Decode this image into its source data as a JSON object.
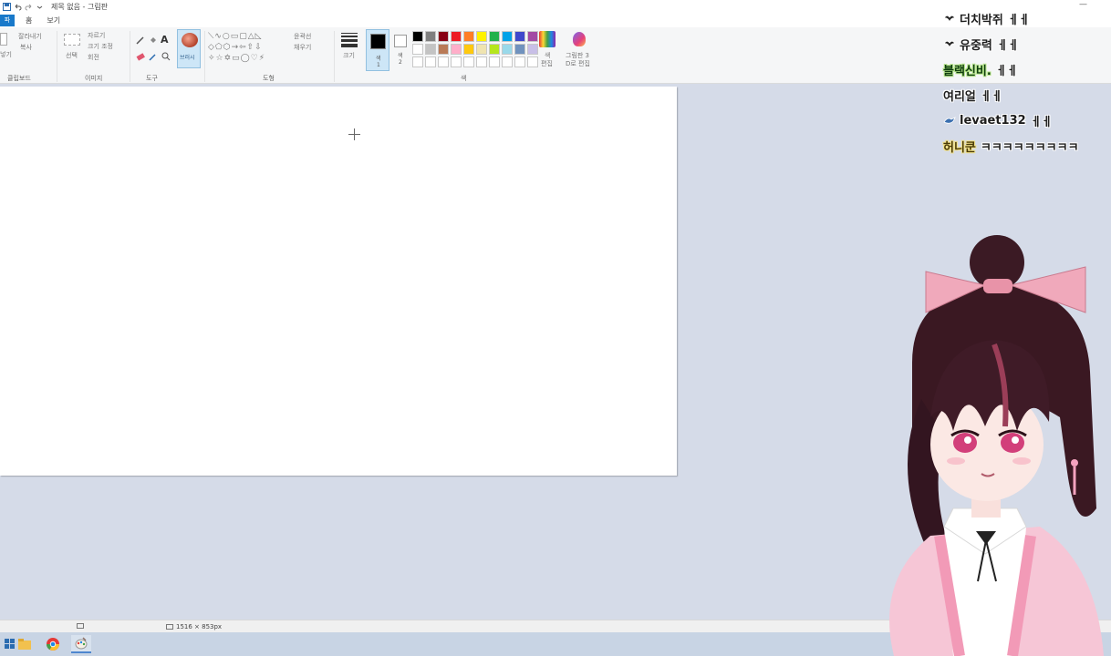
{
  "window": {
    "title": "제목 없음 - 그림판",
    "minimize": "—"
  },
  "tabs": {
    "file": "파",
    "home": "홈",
    "view": "보기"
  },
  "ribbon": {
    "clipboard": {
      "paste": "붙여",
      "paste2": "넣기",
      "cut": "잘라내기",
      "copy": "복사",
      "label": "클립보드"
    },
    "image": {
      "select": "선택",
      "crop": "자르기",
      "resize": "크기 조정",
      "rotate": "회전",
      "label": "이미지"
    },
    "tools": {
      "label": "도구"
    },
    "brushes": {
      "label": "브러시"
    },
    "shapes": {
      "outline": "윤곽선",
      "fill": "채우기",
      "label": "도형"
    },
    "size": {
      "label": "크기"
    },
    "colors": {
      "color1_label": "색",
      "color1_num": "1",
      "color2_label": "색",
      "color2_num": "2",
      "edit": "색",
      "edit2": "편집",
      "paint3d": "그림판 3",
      "paint3d2": "D로 편집",
      "label": "색",
      "palette": [
        "#000000",
        "#7f7f7f",
        "#880015",
        "#ed1c24",
        "#ff7f27",
        "#fff200",
        "#22b14c",
        "#00a2e8",
        "#3f48cc",
        "#a349a4",
        "#ffffff",
        "#c3c3c3",
        "#b97a57",
        "#ffaec9",
        "#ffc90e",
        "#efe4b0",
        "#b5e61d",
        "#99d9ea",
        "#7092be",
        "#c8bfe7",
        "#ffffff",
        "#ffffff",
        "#ffffff",
        "#ffffff",
        "#ffffff",
        "#ffffff",
        "#ffffff",
        "#ffffff",
        "#ffffff",
        "#ffffff"
      ]
    }
  },
  "status": {
    "size": "1516 × 853px"
  },
  "chat": [
    {
      "nick": "더치박쥐",
      "msg": "ㅔㅔ",
      "style": "nick",
      "badge": "bat"
    },
    {
      "nick": "유중력",
      "msg": "ㅔㅔ",
      "style": "nick",
      "badge": "bat"
    },
    {
      "nick": "블랙신비.",
      "msg": "ㅔㅔ",
      "style": "nick-green",
      "badge": ""
    },
    {
      "nick": "여리얼",
      "msg": "ㅔㅔ",
      "style": "nick",
      "badge": ""
    },
    {
      "nick": "levaet132",
      "msg": "ㅔㅔ",
      "style": "nick",
      "badge": "bird"
    },
    {
      "nick": "허니쿤",
      "msg": "ㅋㅋㅋㅋㅋㅋㅋㅋㅋ",
      "style": "nick-gold",
      "badge": ""
    }
  ]
}
